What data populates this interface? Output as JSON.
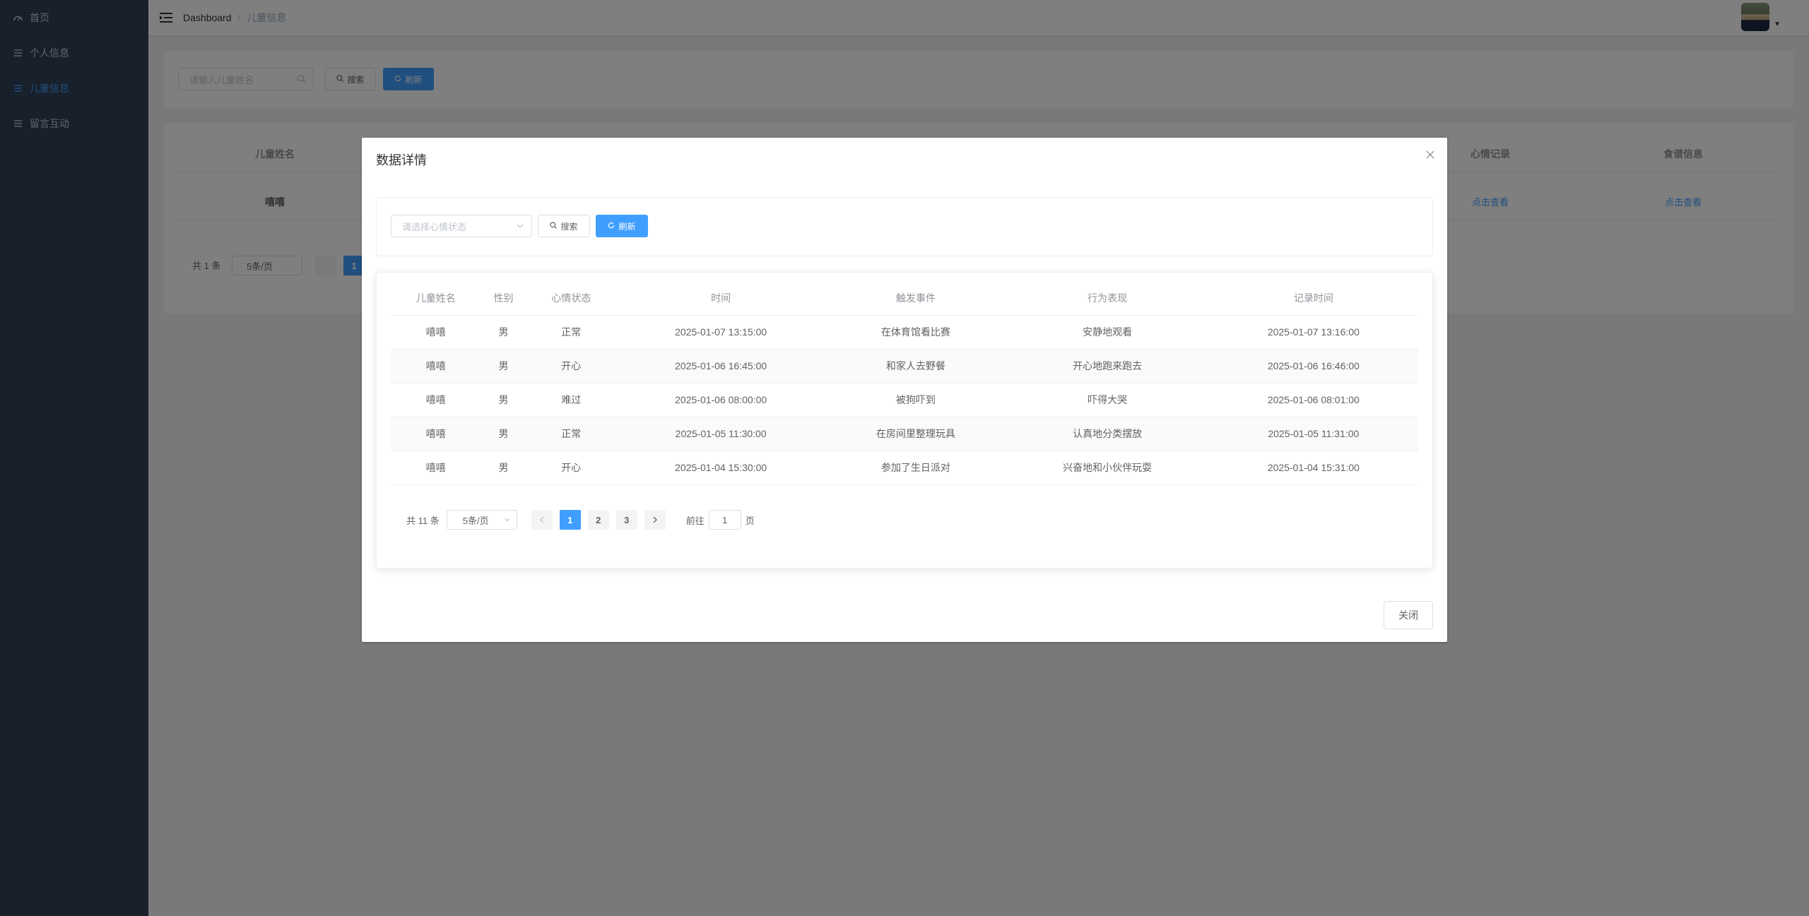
{
  "sidebar": {
    "items": [
      {
        "label": "首页",
        "icon": "dashboard-icon"
      },
      {
        "label": "个人信息",
        "icon": "list-icon"
      },
      {
        "label": "儿童信息",
        "icon": "list-icon",
        "active": true
      },
      {
        "label": "留言互动",
        "icon": "list-icon"
      }
    ]
  },
  "header": {
    "breadcrumb": [
      "Dashboard",
      "儿童信息"
    ]
  },
  "page": {
    "search_placeholder": "请输入儿童姓名",
    "search_label": "搜索",
    "refresh_label": "刷新",
    "table_headers": {
      "name": "儿童姓名",
      "mood_record": "心情记录",
      "diet_info": "食谱信息"
    },
    "row": {
      "name": "嘻嘻",
      "mood_link": "点击查看",
      "diet_link": "点击查看"
    },
    "pager_total": "共 1 条",
    "pager_size": "5条/页",
    "pager_current": "1"
  },
  "dialog": {
    "title": "数据详情",
    "mood_select_placeholder": "请选择心情状态",
    "search_label": "搜索",
    "refresh_label": "刷新",
    "columns": [
      "儿童姓名",
      "性别",
      "心情状态",
      "时间",
      "触发事件",
      "行为表现",
      "记录时间"
    ],
    "rows": [
      [
        "嘻嘻",
        "男",
        "正常",
        "2025-01-07 13:15:00",
        "在体育馆看比赛",
        "安静地观看",
        "2025-01-07 13:16:00"
      ],
      [
        "嘻嘻",
        "男",
        "开心",
        "2025-01-06 16:45:00",
        "和家人去野餐",
        "开心地跑来跑去",
        "2025-01-06 16:46:00"
      ],
      [
        "嘻嘻",
        "男",
        "难过",
        "2025-01-06 08:00:00",
        "被狗吓到",
        "吓得大哭",
        "2025-01-06 08:01:00"
      ],
      [
        "嘻嘻",
        "男",
        "正常",
        "2025-01-05 11:30:00",
        "在房间里整理玩具",
        "认真地分类摆放",
        "2025-01-05 11:31:00"
      ],
      [
        "嘻嘻",
        "男",
        "开心",
        "2025-01-04 15:30:00",
        "参加了生日派对",
        "兴奋地和小伙伴玩耍",
        "2025-01-04 15:31:00"
      ]
    ],
    "pager": {
      "total": "共 11 条",
      "size": "5条/页",
      "pages": [
        "1",
        "2",
        "3"
      ],
      "current": "1",
      "goto_prefix": "前往",
      "goto_value": "1",
      "goto_suffix": "页"
    },
    "close_label": "关闭"
  },
  "colors": {
    "sidebar_bg": "#304156",
    "accent": "#409eff"
  }
}
